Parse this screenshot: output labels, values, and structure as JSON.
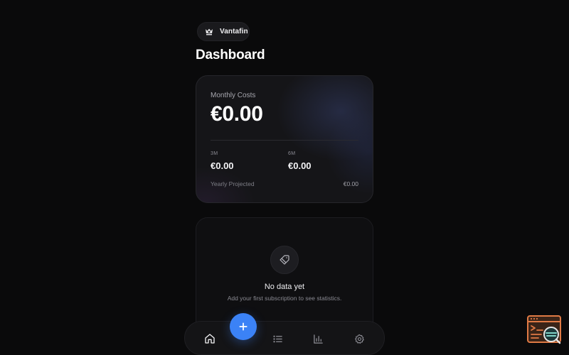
{
  "brand": {
    "name": "Vantafin",
    "logo_icon": "crown-shield-icon"
  },
  "page": {
    "title": "Dashboard"
  },
  "costs": {
    "label": "Monthly Costs",
    "value": "€0.00",
    "periods": [
      {
        "label": "3M",
        "value": "€0.00"
      },
      {
        "label": "6M",
        "value": "€0.00"
      }
    ],
    "yearly_label": "Yearly Projected",
    "yearly_value": "€0.00"
  },
  "stats": {
    "icon": "tag-icon",
    "empty_title": "No data yet",
    "empty_subtitle": "Add your first subscription to see statistics."
  },
  "nav": {
    "items": [
      {
        "name": "home",
        "icon": "home-icon",
        "active": true
      },
      {
        "name": "subscriptions",
        "icon": "list-icon",
        "active": false
      },
      {
        "name": "statistics",
        "icon": "bar-chart-icon",
        "active": false
      },
      {
        "name": "settings",
        "icon": "gear-icon",
        "active": false
      }
    ],
    "add_icon": "plus-icon"
  },
  "colors": {
    "background": "#0a0a0b",
    "card": "#151518",
    "accent": "#3b82f6",
    "text_primary": "#ffffff",
    "text_muted": "#8a8a92"
  }
}
